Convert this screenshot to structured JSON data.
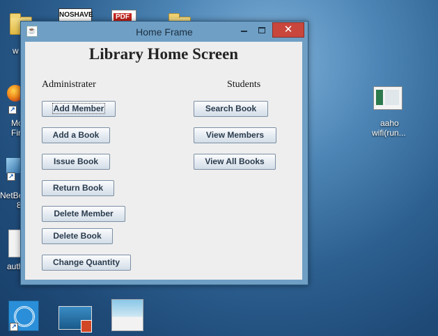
{
  "desktop": {
    "icons": [
      {
        "label": "w",
        "icon": "folder-icon"
      },
      {
        "label": "",
        "icon": "noshave-icon",
        "brand": "NOSHAVE"
      },
      {
        "label": "",
        "icon": "pdf-icon",
        "badge": "PDF"
      },
      {
        "label": "",
        "icon": "folder-icon"
      },
      {
        "label": "Mo",
        "label2": "Fir",
        "icon": "firefox-icon"
      },
      {
        "label": "NetBe",
        "label2": "8",
        "icon": "netbeans-icon"
      },
      {
        "label": "auth",
        "icon": "document-icon"
      },
      {
        "label": "aaho",
        "label2": "wifi(run...",
        "icon": "app-window-icon"
      }
    ]
  },
  "window": {
    "title": "Home Frame",
    "heading": "Library Home Screen",
    "administrator_label": "Administrater",
    "students_label": "Students",
    "admin_buttons": [
      "Add Member",
      "Add a Book",
      "Issue Book",
      "Return Book",
      "Delete Member",
      "Delete Book",
      "Change Quantity"
    ],
    "student_buttons": [
      "Search Book",
      "View Members",
      "View All Books"
    ],
    "close_glyph": "✕"
  },
  "colors": {
    "close_button": "#c9463d",
    "window_frame": "#6f9fc4",
    "content_bg": "#eeeeee"
  }
}
